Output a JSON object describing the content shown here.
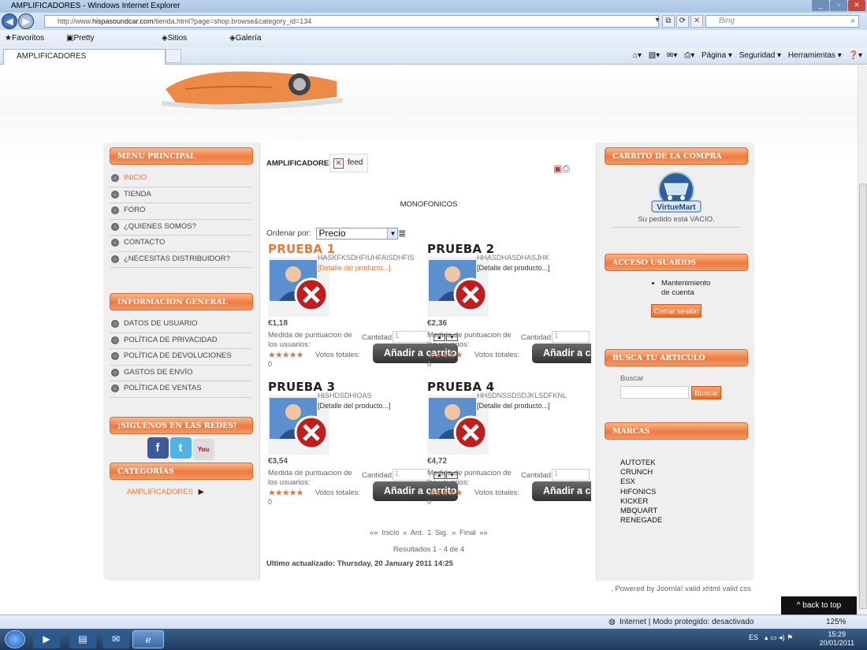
{
  "browser": {
    "title": "AMPLIFICADORES - Windows Internet Explorer",
    "address_prefix": "http://www.",
    "address_domain": "hispasoundcar.com",
    "address_path": "/tienda.html?page=shop.browse&category_id=134",
    "search_placeholder": "Bing",
    "favorites_label": "Favoritos",
    "fav_links": [
      "Pretty Little Liars online @...",
      "Sitios sugeridos ▾",
      "Galería de Web Slice ▾"
    ],
    "tab_title": "AMPLIFICADORES",
    "command_bar": [
      "Página ▾",
      "Seguridad ▾",
      "Herramientas ▾"
    ],
    "status_text": "Internet | Modo protegido: desactivado",
    "zoom": "125%"
  },
  "left": {
    "menu_title": "MENU PRINCIPAL",
    "menu_items": [
      "INICIO",
      "TIENDA",
      "FORO",
      "¿QUIENES SOMOS?",
      "CONTACTO",
      "¿NECESITAS DISTRIBUIDOR?"
    ],
    "info_title": "INFORMACION GENERAL",
    "info_items": [
      "DATOS DE USUARIO",
      "POLÍTICA DE PRIVACIDAD",
      "POLÍTICA DE DEVOLUCIONES",
      "GASTOS DE ENVÍO",
      "POLÍTICA DE VENTAS"
    ],
    "social_title": "¡SIGUENOS EN LAS REDES!",
    "categories_title": "CATEGORÍAS",
    "category_item": "AMPLIFICADORES"
  },
  "center": {
    "category_title": "AMPLIFICADORES",
    "feed_label": "feed",
    "subcategory": "MONOFONICOS",
    "sort_label": "Ordenar por:",
    "sort_value": "Precio",
    "products": [
      {
        "name": "PRUEBA 1",
        "desc": "HASKFKSDHFIUHFAISDHFIS",
        "detail": "[Detalle del producto...]",
        "price": "€1,18",
        "rating_label": "Medida de puntuacion de los usuarios:",
        "votes_label": "Votos totales:",
        "votes": "0",
        "qty_label": "Cantidad:",
        "qty": "1",
        "add_label": "Añadir a carrito"
      },
      {
        "name": "PRUEBA 2",
        "desc": "HHASDHASDHASJHK",
        "detail": "[Detalle del producto...]",
        "price": "€2,36",
        "rating_label": "Medida de puntuacion de los usuarios:",
        "votes_label": "Votos totales:",
        "votes": "0",
        "qty_label": "Cantidad:",
        "qty": "1",
        "add_label": "Añadir a carrito"
      },
      {
        "name": "PRUEBA 3",
        "desc": "HISHDSDHIOAS",
        "detail": "[Detalle del producto...]",
        "price": "€3,54",
        "rating_label": "Medida de puntuacion de los usuarios:",
        "votes_label": "Votos totales:",
        "votes": "0",
        "qty_label": "Cantidad:",
        "qty": "1",
        "add_label": "Añadir a carrito"
      },
      {
        "name": "PRUEBA 4",
        "desc": "HHSDNSSDSDJKLSDFKNL",
        "detail": "[Detalle del producto...]",
        "price": "€4,72",
        "rating_label": "Medida de puntuacion de los usuarios:",
        "votes_label": "Votos totales:",
        "votes": "0",
        "qty_label": "Cantidad:",
        "qty": "1",
        "add_label": "Añadir a carrito"
      }
    ],
    "pager": [
      "«« Inicio",
      "« Ant.",
      "1",
      "Sig. »",
      "Final »»"
    ],
    "results": "Resultados 1 - 4 de 4",
    "updated": "Ultimo actualizado: Thursday, 20 January 2011 14:25"
  },
  "right": {
    "cart_title": "CARRITO DE LA COMPRA",
    "cart_logo_text": "VirtueMart",
    "cart_empty": "Su pedido está VACIO.",
    "login_title": "ACCESO USUARIOS",
    "login_item": "Mantenimiento de cuenta",
    "logout_label": "Cerrar sesión",
    "search_title": "BUSCA TU ARTICULO",
    "search_label": "Buscar",
    "search_button": "Buscar",
    "brands_title": "MARCAS",
    "brands": [
      "AUTOTEK",
      "CRUNCH",
      "ESX",
      "HIFONICS",
      "KICKER",
      "MBQUART",
      "RENEGADE"
    ]
  },
  "footer": {
    "powered": ", Powered by Joomla! valid xhtml valid css",
    "back_to_top": "^ back to top"
  },
  "taskbar": {
    "lang": "ES",
    "time": "15:29",
    "date": "20/01/2011"
  },
  "colors": {
    "accent": "#ee7a3d",
    "button_dark": "#333333",
    "highlight": "#e77a3b"
  }
}
